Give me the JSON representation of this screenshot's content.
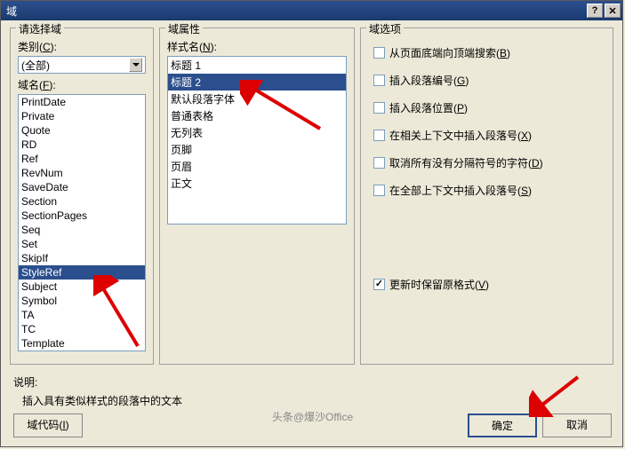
{
  "titlebar": {
    "title": "域"
  },
  "col1": {
    "group_title": "请选择域",
    "category_label": "类别(<u>C</u>):",
    "category_value": "(全部)",
    "fieldname_label": "域名(<u>F</u>):",
    "fields": [
      "PrintDate",
      "Private",
      "Quote",
      "RD",
      "Ref",
      "RevNum",
      "SaveDate",
      "Section",
      "SectionPages",
      "Seq",
      "Set",
      "SkipIf",
      "StyleRef",
      "Subject",
      "Symbol",
      "TA",
      "TC",
      "Template"
    ],
    "selected_field": "StyleRef"
  },
  "col2": {
    "group_title": "域属性",
    "stylename_label": "样式名(<u>N</u>):",
    "styles": [
      "标题 1",
      "标题 2",
      "默认段落字体",
      "普通表格",
      "无列表",
      "页脚",
      "页眉",
      "正文"
    ],
    "selected_style": "标题 2"
  },
  "col3": {
    "group_title": "域选项",
    "options": [
      {
        "label": "从页面底端向顶端搜索(<u>B</u>)",
        "checked": false
      },
      {
        "label": "插入段落编号(<u>G</u>)",
        "checked": false
      },
      {
        "label": "插入段落位置(<u>P</u>)",
        "checked": false
      },
      {
        "label": "在相关上下文中插入段落号(<u>X</u>)",
        "checked": false
      },
      {
        "label": "取消所有没有分隔符号的字符(<u>D</u>)",
        "checked": false
      },
      {
        "label": "在全部上下文中插入段落号(<u>S</u>)",
        "checked": false
      }
    ],
    "preserve_label": "更新时保留原格式(<u>V</u>)",
    "preserve_checked": true
  },
  "desc": {
    "label": "说明:",
    "text": "插入具有类似样式的段落中的文本"
  },
  "footer": {
    "fieldcode": "域代码(<u>I</u>)",
    "ok": "确定",
    "cancel": "取消"
  },
  "watermark": "头条@爆沙Office"
}
